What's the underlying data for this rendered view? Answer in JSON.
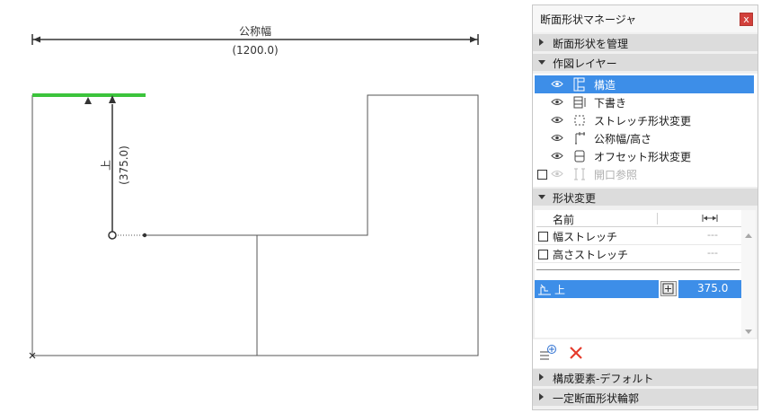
{
  "drawing": {
    "dim_top_label": "公称幅",
    "dim_top_value": "(1200.0)",
    "dim_vert_label": "上",
    "dim_vert_value": "(375.0)"
  },
  "panel": {
    "title": "断面形状マネージャ",
    "close_label": "x",
    "sections": {
      "manage": "断面形状を管理",
      "layers": "作図レイヤー",
      "shape_change": "形状変更",
      "components": "構成要素-デフォルト",
      "fixed_outline": "一定断面形状輪郭"
    },
    "layers": [
      {
        "label": "構造",
        "icon": "structure-layer-icon"
      },
      {
        "label": "下書き",
        "icon": "draft-layer-icon"
      },
      {
        "label": "ストレッチ形状変更",
        "icon": "stretch-layer-icon"
      },
      {
        "label": "公称幅/高さ",
        "icon": "nominal-size-icon"
      },
      {
        "label": "オフセット形状変更",
        "icon": "offset-layer-icon"
      },
      {
        "label": "開口参照",
        "icon": "opening-ref-icon"
      }
    ],
    "table": {
      "col_name": "名前",
      "rows": [
        {
          "name": "幅ストレッチ",
          "value": "---"
        },
        {
          "name": "高さストレッチ",
          "value": "---"
        }
      ],
      "selected": {
        "name": "上",
        "value": "375.0"
      }
    },
    "colors": {
      "accent": "#3d8ee8",
      "edge": "#3cc43c",
      "close": "#d2403b",
      "delete": "#e53b2c"
    }
  }
}
